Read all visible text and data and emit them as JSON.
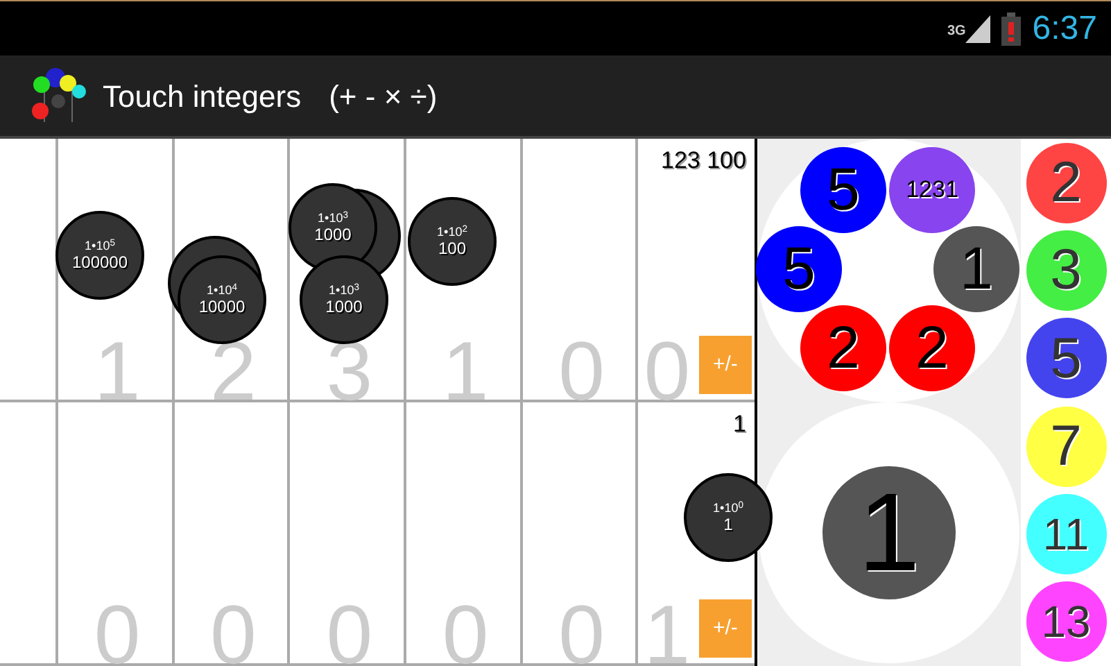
{
  "status_bar": {
    "network": "3G",
    "time": "6:37"
  },
  "action_bar": {
    "title": "Touch integers",
    "operators": "(+ - × ÷)"
  },
  "board": {
    "rows": [
      {
        "digits": [
          "1",
          "2",
          "3",
          "1",
          "0",
          "0"
        ],
        "reading": "123 100",
        "sign_button": "+/-"
      },
      {
        "digits": [
          "0",
          "0",
          "0",
          "0",
          "0",
          "1"
        ],
        "reading": "1",
        "sign_button": "+/-"
      }
    ],
    "tokens": [
      {
        "kind": "token",
        "power": "1•10$^{5}$",
        "value": "100000",
        "stacked": false
      },
      {
        "kind": "token",
        "power": "1•10$^{4}$",
        "value": "10000",
        "stacked": true
      },
      {
        "kind": "token",
        "power": "1•10$^{3}$",
        "value": "1000",
        "stacked": true
      },
      {
        "kind": "token",
        "power": "1•10$^{3}$",
        "value": "1000",
        "stacked": false
      },
      {
        "kind": "token",
        "power": "1•10$^{2}$",
        "value": "100",
        "stacked": false
      },
      {
        "kind": "token",
        "power": "1•10$^{0}$",
        "value": "1",
        "stacked": false
      }
    ]
  },
  "workspace": {
    "top_balls": [
      {
        "label": "5",
        "color": "#0000ff"
      },
      {
        "label": "1231",
        "color": "#8844ee"
      },
      {
        "label": "5",
        "color": "#0000ff"
      },
      {
        "label": "1",
        "color": "#555555"
      },
      {
        "label": "2",
        "color": "#ff0000"
      },
      {
        "label": "2",
        "color": "#ff0000"
      }
    ],
    "bottom_ball": {
      "label": "1",
      "color": "#555555"
    }
  },
  "palette": [
    {
      "label": "2",
      "color": "#ff4444"
    },
    {
      "label": "3",
      "color": "#44ee44"
    },
    {
      "label": "5",
      "color": "#4444ee"
    },
    {
      "label": "7",
      "color": "#ffff44"
    },
    {
      "label": "11",
      "color": "#44ffff"
    },
    {
      "label": "13",
      "color": "#ff44ff"
    }
  ]
}
